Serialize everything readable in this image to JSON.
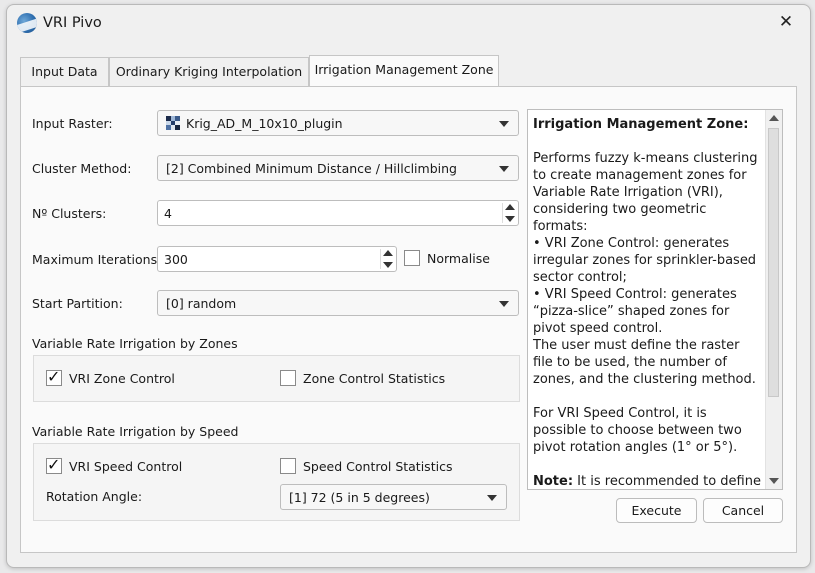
{
  "window": {
    "title": "VRI Pivo",
    "close_glyph": "✕",
    "app_icon": "globe-logo-icon"
  },
  "tabs": [
    {
      "label": "Input Data"
    },
    {
      "label": "Ordinary Kriging Interpolation"
    },
    {
      "label": "Irrigation Management Zone"
    }
  ],
  "form": {
    "input_raster": {
      "label": "Input Raster:",
      "value": "Krig_AD_M_10x10_plugin"
    },
    "cluster_method": {
      "label": "Cluster Method:",
      "value": "[2] Combined Minimum Distance / Hillclimbing"
    },
    "n_clusters": {
      "label": "Nº Clusters:",
      "value": "4"
    },
    "max_iterations": {
      "label": "Maximum Iterations:",
      "value": "300"
    },
    "normalise": {
      "label": "Normalise",
      "checked": false
    },
    "start_partition": {
      "label": "Start Partition:",
      "value": "[0] random"
    }
  },
  "zones_group": {
    "title": "Variable Rate Irrigation by Zones",
    "vri_zone_control": {
      "label": "VRI Zone Control",
      "checked": true
    },
    "zone_control_stats": {
      "label": "Zone Control Statistics",
      "checked": false
    }
  },
  "speed_group": {
    "title": "Variable Rate Irrigation by Speed",
    "vri_speed_control": {
      "label": "VRI Speed Control",
      "checked": true
    },
    "speed_control_stats": {
      "label": "Speed Control Statistics",
      "checked": false
    },
    "rotation_angle": {
      "label": "Rotation Angle:",
      "value": "[1] 72 (5 in 5 degrees)"
    }
  },
  "checkmark_glyph": "✓",
  "help": {
    "heading": "Irrigation Management Zone:",
    "p1": "Performs fuzzy k-means clustering to create management zones for Variable Rate Irrigation (VRI), considering two geometric formats:",
    "b1": "• VRI Zone Control: generates irregular zones for sprinkler-based sector control;",
    "b2": "• VRI Speed Control: generates “pizza-slice” shaped zones for pivot speed control.",
    "p2": "The user must define the raster file to be used, the number of zones, and the clustering method.",
    "p3": "For VRI Speed Control, it is possible to choose between two pivot rotation angles (1° or 5°).",
    "note_label": "Note:",
    "note_text": " It is recommended to define the number of zones based on"
  },
  "buttons": {
    "execute": "Execute",
    "cancel": "Cancel"
  },
  "colors": {
    "window_bg": "#f0f0f0",
    "pane_bg": "#fafafa",
    "border": "#c6c6c6"
  }
}
